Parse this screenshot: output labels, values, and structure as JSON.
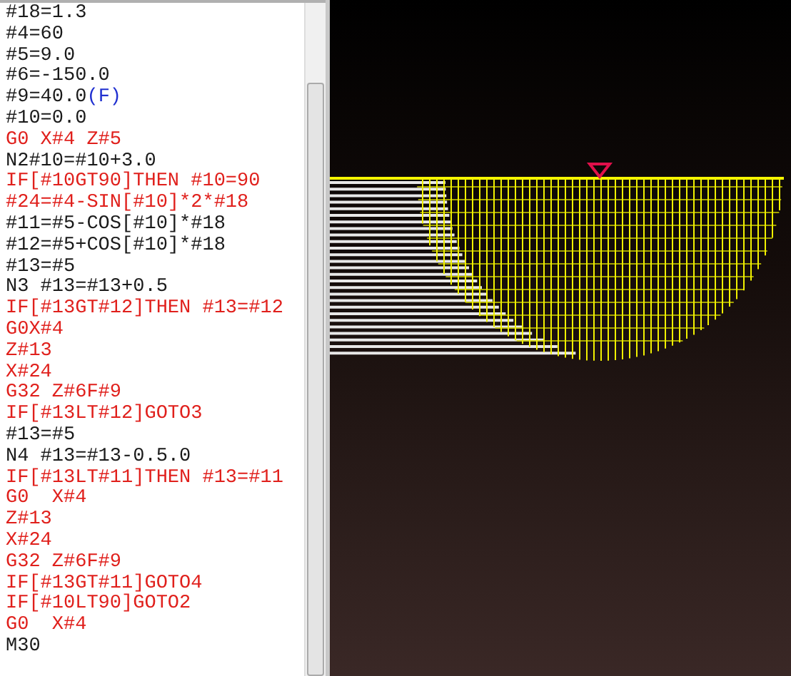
{
  "code_lines": [
    {
      "segments": [
        {
          "text": "#18=1.3",
          "kind": "plain"
        }
      ]
    },
    {
      "segments": [
        {
          "text": "#4=60",
          "kind": "plain"
        }
      ]
    },
    {
      "segments": [
        {
          "text": "#5=9.0",
          "kind": "plain"
        }
      ]
    },
    {
      "segments": [
        {
          "text": "#6=-150.0",
          "kind": "plain"
        }
      ]
    },
    {
      "segments": [
        {
          "text": "#9=40.0",
          "kind": "plain"
        },
        {
          "text": "(F)",
          "kind": "comment"
        }
      ]
    },
    {
      "segments": [
        {
          "text": "#10=0.0",
          "kind": "plain"
        }
      ]
    },
    {
      "segments": [
        {
          "text": "G0 X#4 Z#5",
          "kind": "command"
        }
      ]
    },
    {
      "segments": [
        {
          "text": "N2#10=#10+3.0",
          "kind": "plain"
        }
      ]
    },
    {
      "segments": [
        {
          "text": "IF[#10GT90]THEN #10=90",
          "kind": "command"
        }
      ]
    },
    {
      "segments": [
        {
          "text": "#24=#4-SIN[#10]*2*#18",
          "kind": "command"
        }
      ]
    },
    {
      "segments": [
        {
          "text": "#11=#5-COS[#10]*#18",
          "kind": "plain"
        }
      ]
    },
    {
      "segments": [
        {
          "text": "#12=#5+COS[#10]*#18",
          "kind": "plain"
        }
      ]
    },
    {
      "segments": [
        {
          "text": "#13=#5",
          "kind": "plain"
        }
      ]
    },
    {
      "segments": [
        {
          "text": "N3 #13=#13+0.5",
          "kind": "plain"
        }
      ]
    },
    {
      "segments": [
        {
          "text": "IF[#13GT#12]THEN #13=#12",
          "kind": "command"
        }
      ]
    },
    {
      "segments": [
        {
          "text": "G0X#4",
          "kind": "command"
        }
      ]
    },
    {
      "segments": [
        {
          "text": "Z#13",
          "kind": "command"
        }
      ]
    },
    {
      "segments": [
        {
          "text": "X#24",
          "kind": "command"
        }
      ]
    },
    {
      "segments": [
        {
          "text": "G32 Z#6F#9",
          "kind": "command"
        }
      ]
    },
    {
      "segments": [
        {
          "text": "IF[#13LT#12]GOTO3",
          "kind": "command"
        }
      ]
    },
    {
      "segments": [
        {
          "text": "#13=#5",
          "kind": "plain"
        }
      ]
    },
    {
      "segments": [
        {
          "text": "N4 #13=#13-0.5.0",
          "kind": "plain"
        }
      ]
    },
    {
      "segments": [
        {
          "text": "IF[#13LT#11]THEN #13=#11",
          "kind": "command"
        }
      ]
    },
    {
      "segments": [
        {
          "text": "G0  X#4",
          "kind": "command"
        }
      ]
    },
    {
      "segments": [
        {
          "text": "Z#13",
          "kind": "command"
        }
      ]
    },
    {
      "segments": [
        {
          "text": "X#24",
          "kind": "command"
        }
      ]
    },
    {
      "segments": [
        {
          "text": "G32 Z#6F#9",
          "kind": "command"
        }
      ]
    },
    {
      "segments": [
        {
          "text": "IF[#13GT#11]GOTO4",
          "kind": "command"
        }
      ]
    },
    {
      "segments": [
        {
          "text": "IF[#10LT90]GOTO2",
          "kind": "command"
        }
      ]
    },
    {
      "segments": [
        {
          "text": "G0  X#4",
          "kind": "command"
        }
      ]
    },
    {
      "segments": [
        {
          "text": "M30",
          "kind": "plain"
        }
      ]
    }
  ]
}
